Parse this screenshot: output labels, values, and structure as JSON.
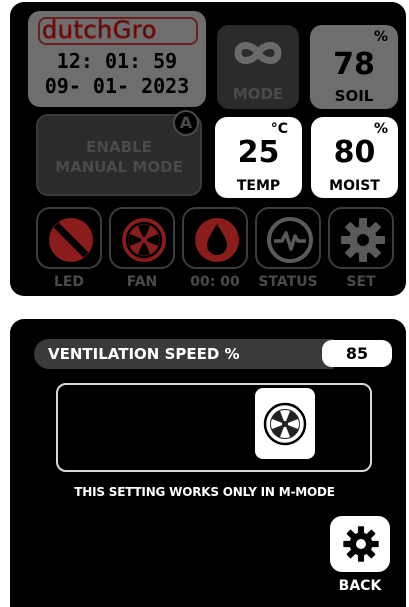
{
  "dashboard": {
    "brand": {
      "part1": "dutch",
      "part2": "Gro"
    },
    "time": "12: 01: 59",
    "date": "09- 01- 2023",
    "mode": {
      "label": "MODE",
      "icon": "infinity-icon"
    },
    "soil": {
      "value": "78",
      "unit": "%",
      "label": "SOIL"
    },
    "manual_mode": {
      "line1": "ENABLE",
      "line2": "MANUAL MODE",
      "badge": "A"
    },
    "temp": {
      "value": "25",
      "unit": "°C",
      "label": "TEMP"
    },
    "moist": {
      "value": "80",
      "unit": "%",
      "label": "MOIST"
    },
    "buttons": [
      {
        "label": "LED",
        "icon": "led-off-icon"
      },
      {
        "label": "FAN",
        "icon": "fan-icon"
      },
      {
        "label": "00: 00",
        "icon": "water-drop-icon"
      },
      {
        "label": "STATUS",
        "icon": "pulse-icon"
      },
      {
        "label": "SET",
        "icon": "gear-icon"
      }
    ],
    "colors": {
      "red": "#8a1c1c",
      "dim": "#2b2b2b",
      "gray": "#6e6e6e"
    }
  },
  "ventilation": {
    "label": "VENTILATION SPEED %",
    "value": "85",
    "note": "THIS SETTING WORKS ONLY IN M-MODE",
    "back_label": "BACK",
    "slider_icon": "fan-icon"
  }
}
